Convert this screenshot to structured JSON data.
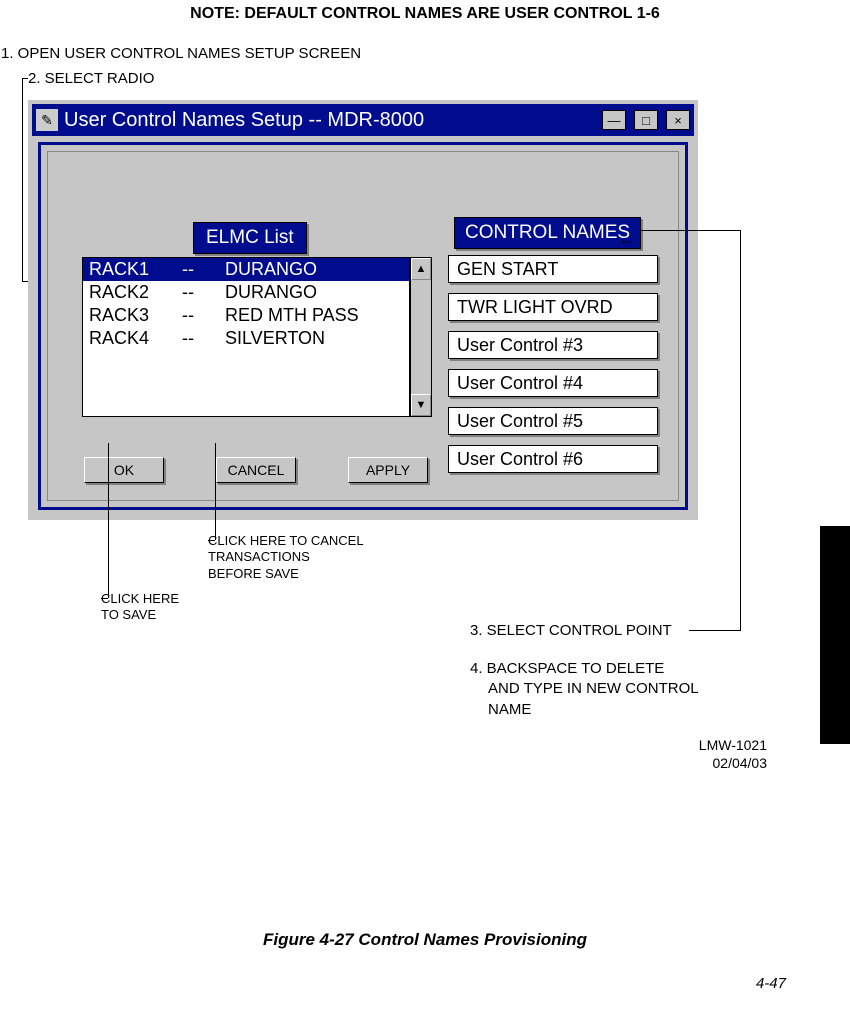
{
  "note_heading": "NOTE: DEFAULT CONTROL NAMES ARE USER CONTROL 1-6",
  "step1": "1. OPEN USER CONTROL NAMES SETUP SCREEN",
  "step2": "2. SELECT RADIO",
  "window": {
    "title": "User Control Names Setup  --  MDR-8000",
    "elmc_label": "ELMC List",
    "items": [
      {
        "rack": "RACK1",
        "dash": "--",
        "name": "DURANGO",
        "selected": true
      },
      {
        "rack": "RACK2",
        "dash": "--",
        "name": "DURANGO",
        "selected": false
      },
      {
        "rack": "RACK3",
        "dash": "--",
        "name": "RED MTH PASS",
        "selected": false
      },
      {
        "rack": "RACK4",
        "dash": "--",
        "name": "SILVERTON",
        "selected": false
      }
    ],
    "controls_label": "CONTROL NAMES",
    "control_names": [
      "GEN START",
      "TWR LIGHT OVRD",
      "User Control #3",
      "User Control #4",
      "User Control #5",
      "User Control #6"
    ],
    "buttons": {
      "ok": "OK",
      "cancel": "CANCEL",
      "apply": "APPLY"
    },
    "scroll_up": "▲",
    "scroll_down": "▼",
    "sys_icon": "✎",
    "min": "—",
    "max": "□",
    "close": "×"
  },
  "callout_ok_line1": "CLICK HERE",
  "callout_ok_line2": "TO SAVE",
  "callout_cancel_line1": "CLICK HERE TO CANCEL",
  "callout_cancel_line2": "TRANSACTIONS",
  "callout_cancel_line3": "BEFORE SAVE",
  "arrow_gen": "←",
  "step3": "3. SELECT CONTROL POINT",
  "step4_line1": "4. BACKSPACE TO DELETE",
  "step4_line2": "AND TYPE IN NEW CONTROL",
  "step4_line3": "NAME",
  "docid_line1": "LMW-1021",
  "docid_line2": "02/04/03",
  "figure_caption": "Figure 4-27   Control Names Provisioning",
  "page_number": "4-47"
}
